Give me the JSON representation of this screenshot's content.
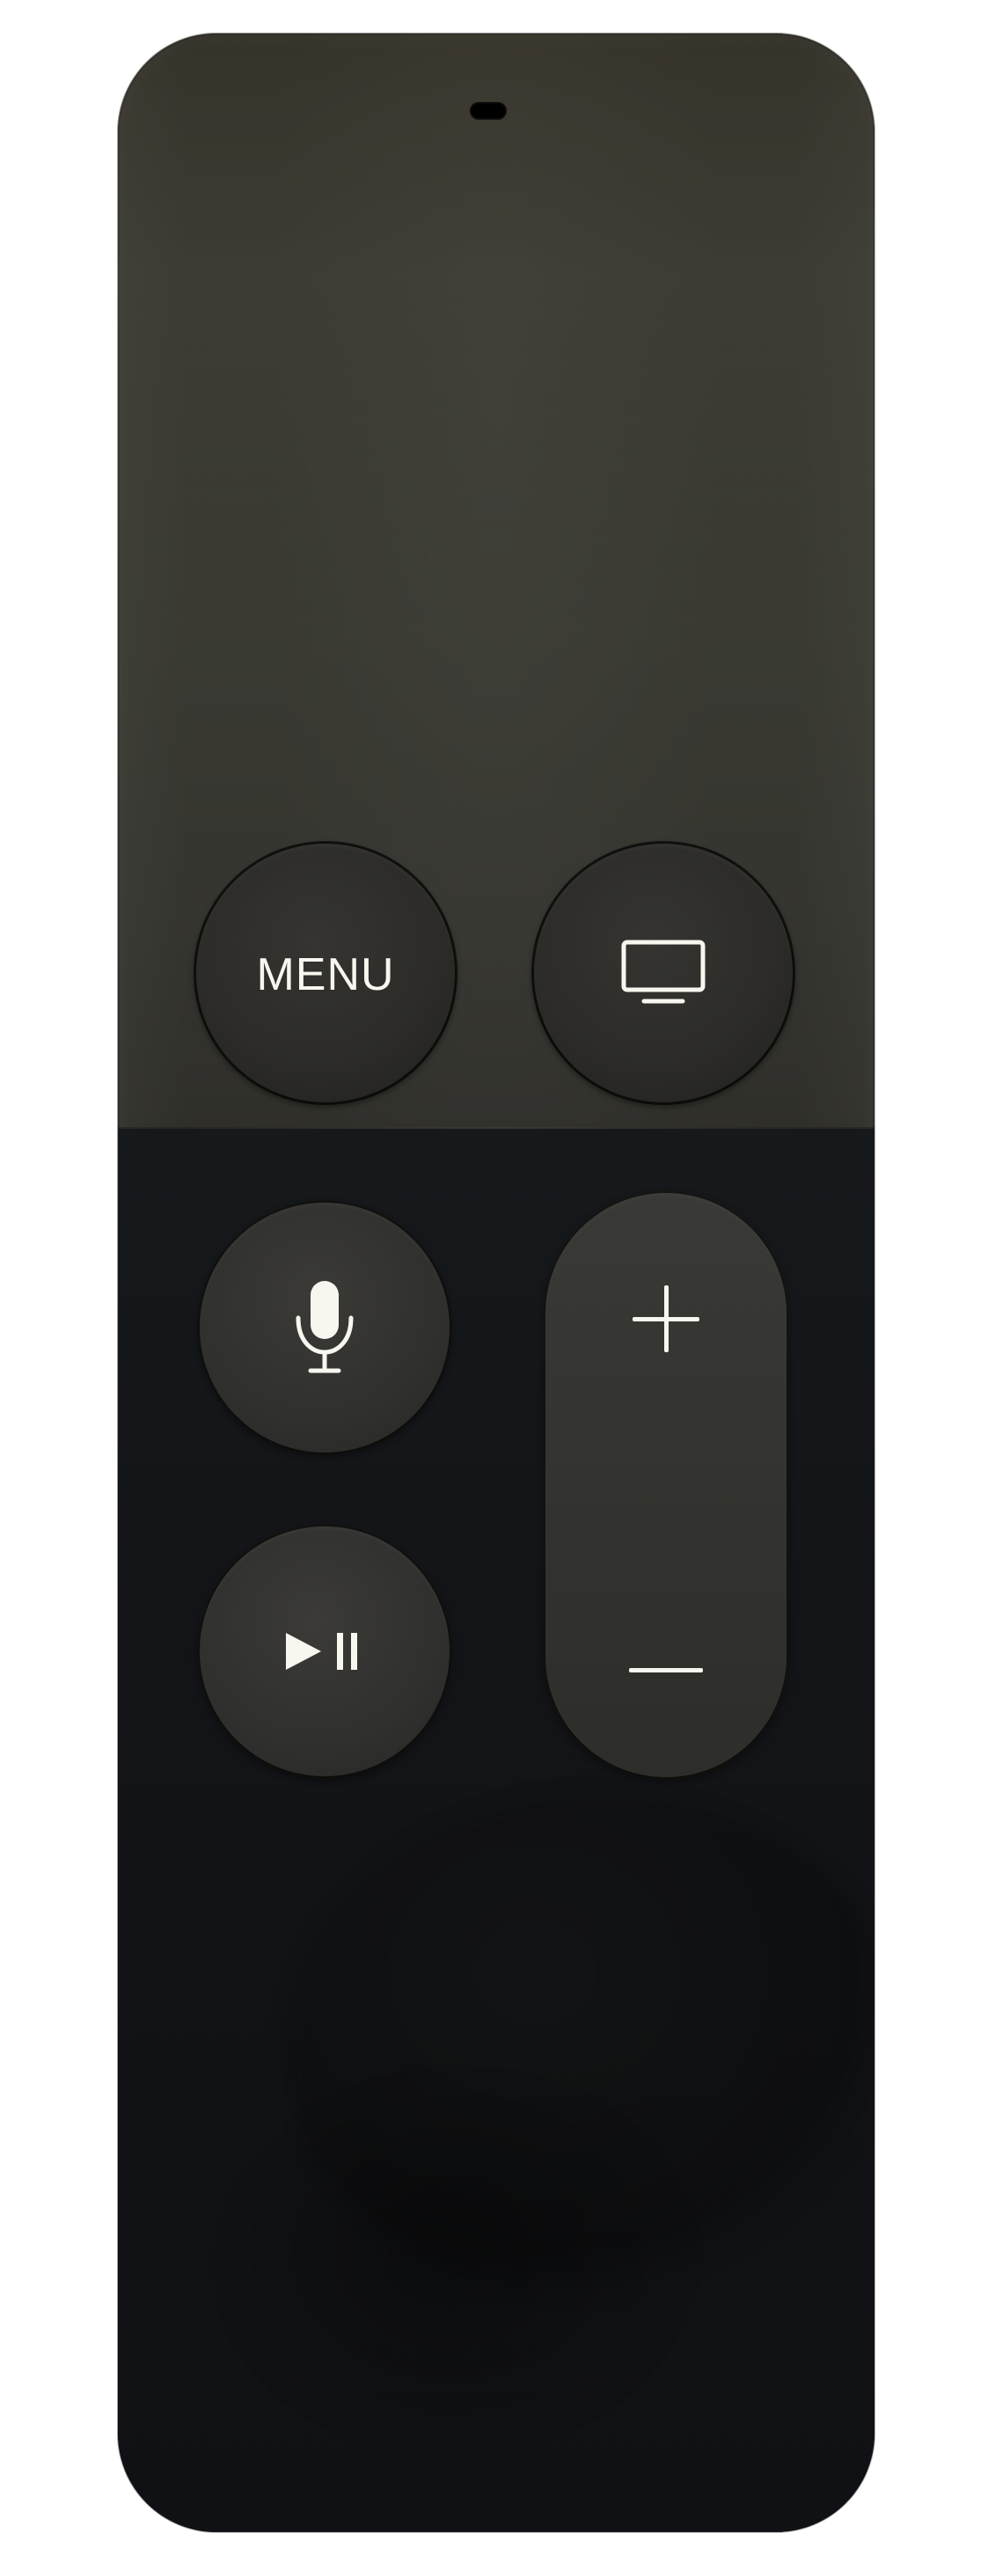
{
  "remote": {
    "buttons": {
      "menu": {
        "label": "MENU"
      },
      "tv": {
        "icon": "tv-icon"
      },
      "siri": {
        "icon": "microphone-icon"
      },
      "play_pause": {
        "icon": "play-pause-icon"
      },
      "volume_up": {
        "icon": "plus-icon"
      },
      "volume_down": {
        "icon": "minus-icon"
      }
    },
    "colors": {
      "surface_top": "#3a3a32",
      "surface_bottom": "#111316",
      "button_fill": "#2f2f2c",
      "icon_color": "#f7f6ef"
    }
  }
}
